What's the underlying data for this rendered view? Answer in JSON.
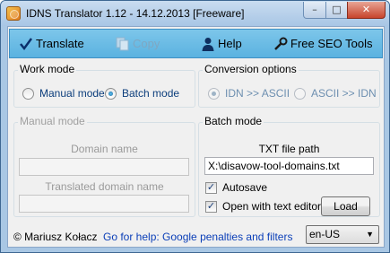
{
  "window": {
    "title": "IDNS Translator 1.12 - 14.12.2013 [Freeware]",
    "minimize_glyph": "–",
    "maximize_glyph": "□",
    "close_glyph": "✕"
  },
  "toolbar": {
    "translate_label": "Translate",
    "copy_label": "Copy",
    "help_label": "Help",
    "seo_label": "Free SEO Tools"
  },
  "work_mode": {
    "title": "Work mode",
    "options": [
      {
        "label": "Manual mode",
        "checked": false
      },
      {
        "label": "Batch mode",
        "checked": true
      }
    ]
  },
  "conversion": {
    "title": "Conversion options",
    "options": [
      {
        "label": "IDN >> ASCII",
        "checked": true
      },
      {
        "label": "ASCII >> IDN",
        "checked": false
      }
    ]
  },
  "manual_mode": {
    "title": "Manual mode",
    "domain_label": "Domain name",
    "domain_value": "",
    "translated_label": "Translated domain name",
    "translated_value": ""
  },
  "batch_mode": {
    "title": "Batch mode",
    "path_label": "TXT file path",
    "path_value": "X:\\disavow-tool-domains.txt",
    "autosave_label": "Autosave",
    "autosave_checked": true,
    "open_editor_label": "Open with text editor",
    "open_editor_checked": true,
    "check_glyph": "✓",
    "load_label": "Load"
  },
  "footer": {
    "author": "© Mariusz Kołacz",
    "help_link": "Go for help: Google penalties and filters",
    "language": "en-US",
    "dropdown_glyph": "▼"
  },
  "colors": {
    "accent": "#5ab2e0",
    "link": "#0b3fb8"
  }
}
